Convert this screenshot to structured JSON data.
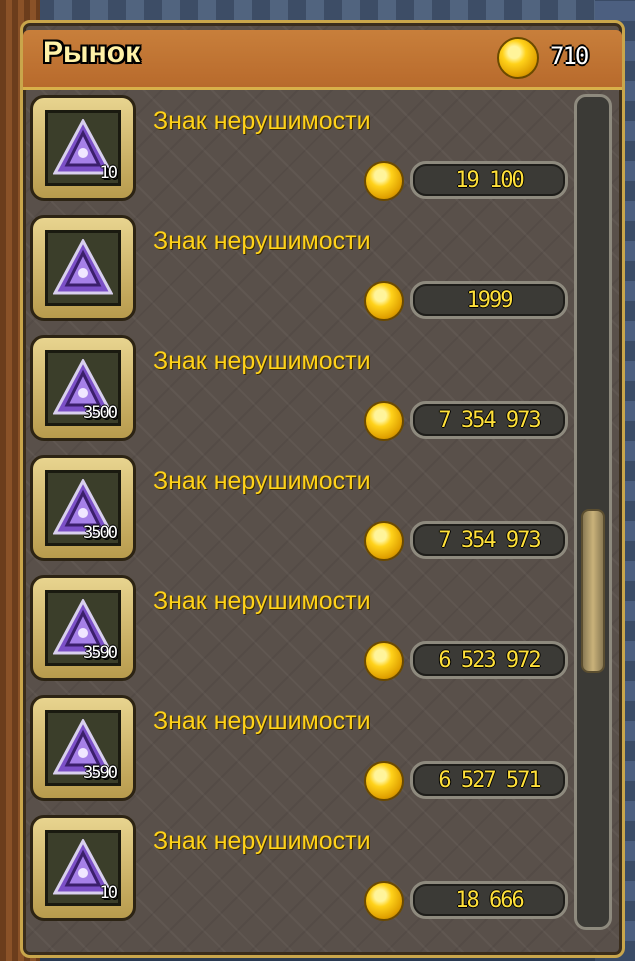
{
  "header": {
    "title": "Рынок",
    "gold": "710",
    "gold_icon": "gold-coin-icon"
  },
  "items": [
    {
      "name": "Знак нерушимости",
      "qty": "10",
      "price": "19 100"
    },
    {
      "name": "Знак нерушимости",
      "qty": "",
      "price": "1999"
    },
    {
      "name": "Знак нерушимости",
      "qty": "3500",
      "price": "7 354 973"
    },
    {
      "name": "Знак нерушимости",
      "qty": "3500",
      "price": "7 354 973"
    },
    {
      "name": "Знак нерушимости",
      "qty": "3590",
      "price": "6 523 972"
    },
    {
      "name": "Знак нерушимости",
      "qty": "3590",
      "price": "6 527 571"
    },
    {
      "name": "Знак нерушимости",
      "qty": "10",
      "price": "18 666"
    }
  ],
  "scroll": {
    "position": 0.62,
    "visible_fraction": 0.2
  },
  "colors": {
    "header": "#c87f3b",
    "panel": "#59504a",
    "item_name": "#ffd21a",
    "price_text": "#ffe03a",
    "rune": "#7b4fc7"
  }
}
